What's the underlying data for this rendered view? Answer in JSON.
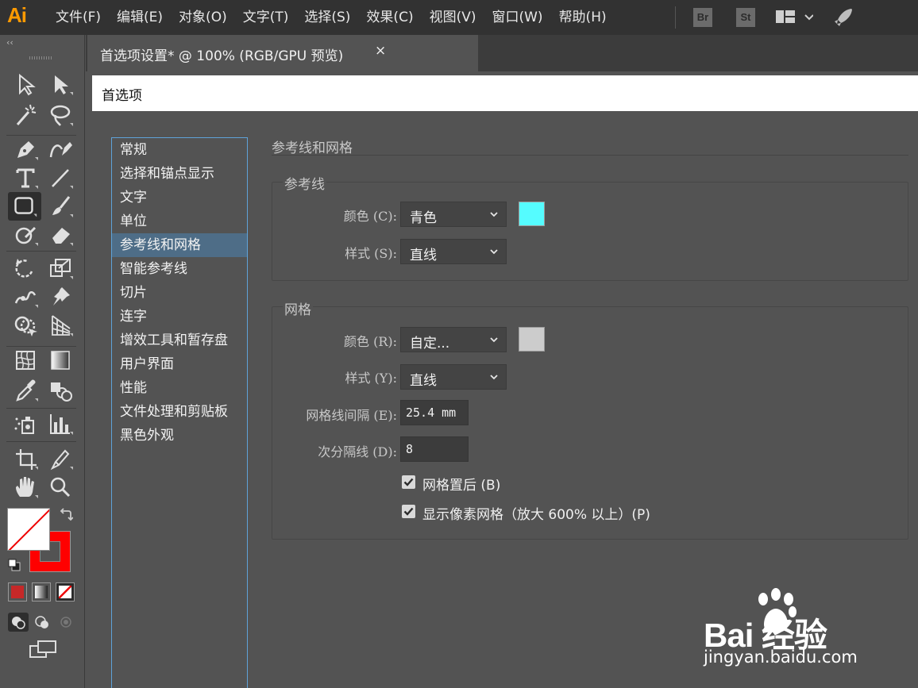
{
  "app": {
    "logo": "Ai",
    "menus": [
      "文件(F)",
      "编辑(E)",
      "对象(O)",
      "文字(T)",
      "选择(S)",
      "效果(C)",
      "视图(V)",
      "窗口(W)",
      "帮助(H)"
    ],
    "badges": [
      "Br",
      "St"
    ]
  },
  "toolpanel": {
    "collapse": "‹‹"
  },
  "document_tab": {
    "title": "首选项设置* @ 100% (RGB/GPU 预览)",
    "close": "×"
  },
  "dialog": {
    "title": "首选项",
    "categories": [
      "常规",
      "选择和锚点显示",
      "文字",
      "单位",
      "参考线和网格",
      "智能参考线",
      "切片",
      "连字",
      "增效工具和暂存盘",
      "用户界面",
      "性能",
      "文件处理和剪贴板",
      "黑色外观"
    ],
    "selected_category": "参考线和网格",
    "section_title": "参考线和网格",
    "guides": {
      "label": "参考线",
      "color_label": "颜色 (C):",
      "color_value": "青色",
      "color_swatch": "#55fcff",
      "style_label": "样式 (S):",
      "style_value": "直线"
    },
    "grid": {
      "label": "网格",
      "color_label": "颜色 (R):",
      "color_value": "自定...",
      "color_swatch": "#cccccc",
      "style_label": "样式 (Y):",
      "style_value": "直线",
      "spacing_label": "网格线间隔 (E):",
      "spacing_value": "25.4 mm",
      "subdivisions_label": "次分隔线 (D):",
      "subdivisions_value": "8",
      "grids_in_back_label": "网格置后 (B)",
      "grids_in_back_checked": true,
      "pixel_grid_label": "显示像素网格（放大 600% 以上）(P)",
      "pixel_grid_checked": true
    }
  },
  "watermark": {
    "logo": "Bai  经验",
    "url": "jingyan.baidu.com"
  },
  "colors": {
    "fill_swatch": "#ffffff",
    "stroke_swatch": "#ff0000",
    "accent": "#5fa3d9",
    "selection": "#4e6d87"
  }
}
